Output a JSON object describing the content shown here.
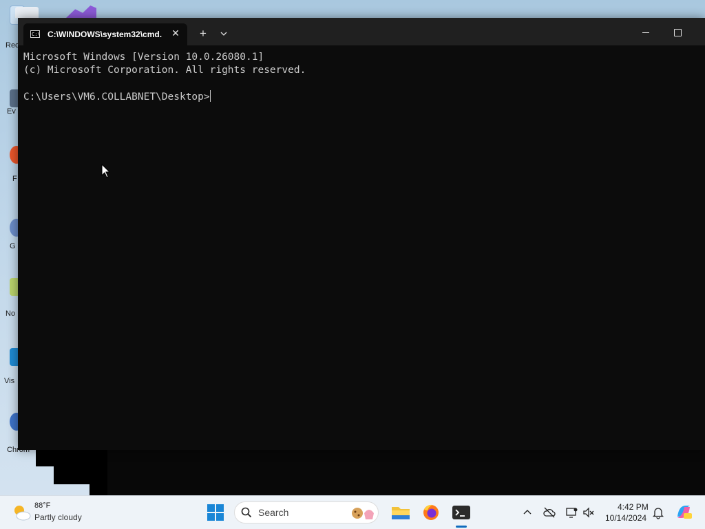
{
  "desktop": {
    "icons": [
      {
        "label": "Rec",
        "icon": "recycle-bin-icon"
      },
      {
        "label": "Ev",
        "icon": "app-shortcut-icon"
      },
      {
        "label": "F",
        "icon": "firefox-icon"
      },
      {
        "label": "G",
        "icon": "app-shortcut-icon"
      },
      {
        "label": "No",
        "icon": "notepad-icon"
      },
      {
        "label": "Vis",
        "icon": "visual-studio-code-icon"
      },
      {
        "label": "Chrom",
        "icon": "chrome-icon"
      }
    ]
  },
  "window": {
    "tab_title": "C:\\WINDOWS\\system32\\cmd.",
    "tab_icon": "cmd-icon",
    "new_tab_label": "+",
    "close_tab_label": "✕"
  },
  "console": {
    "lines": [
      "Microsoft Windows [Version 10.0.26080.1]",
      "(c) Microsoft Corporation. All rights reserved.",
      "",
      "C:\\Users\\VM6.COLLABNET\\Desktop>"
    ]
  },
  "taskbar": {
    "weather": {
      "temperature": "88°F",
      "condition": "Partly cloudy",
      "icon": "partly-cloudy-icon"
    },
    "search_placeholder": "Search",
    "apps": [
      "file-explorer-icon",
      "firefox-icon",
      "terminal-icon"
    ],
    "clock": {
      "time": "4:42 PM",
      "date": "10/14/2024"
    },
    "accent_color": "#0f6cbd"
  }
}
